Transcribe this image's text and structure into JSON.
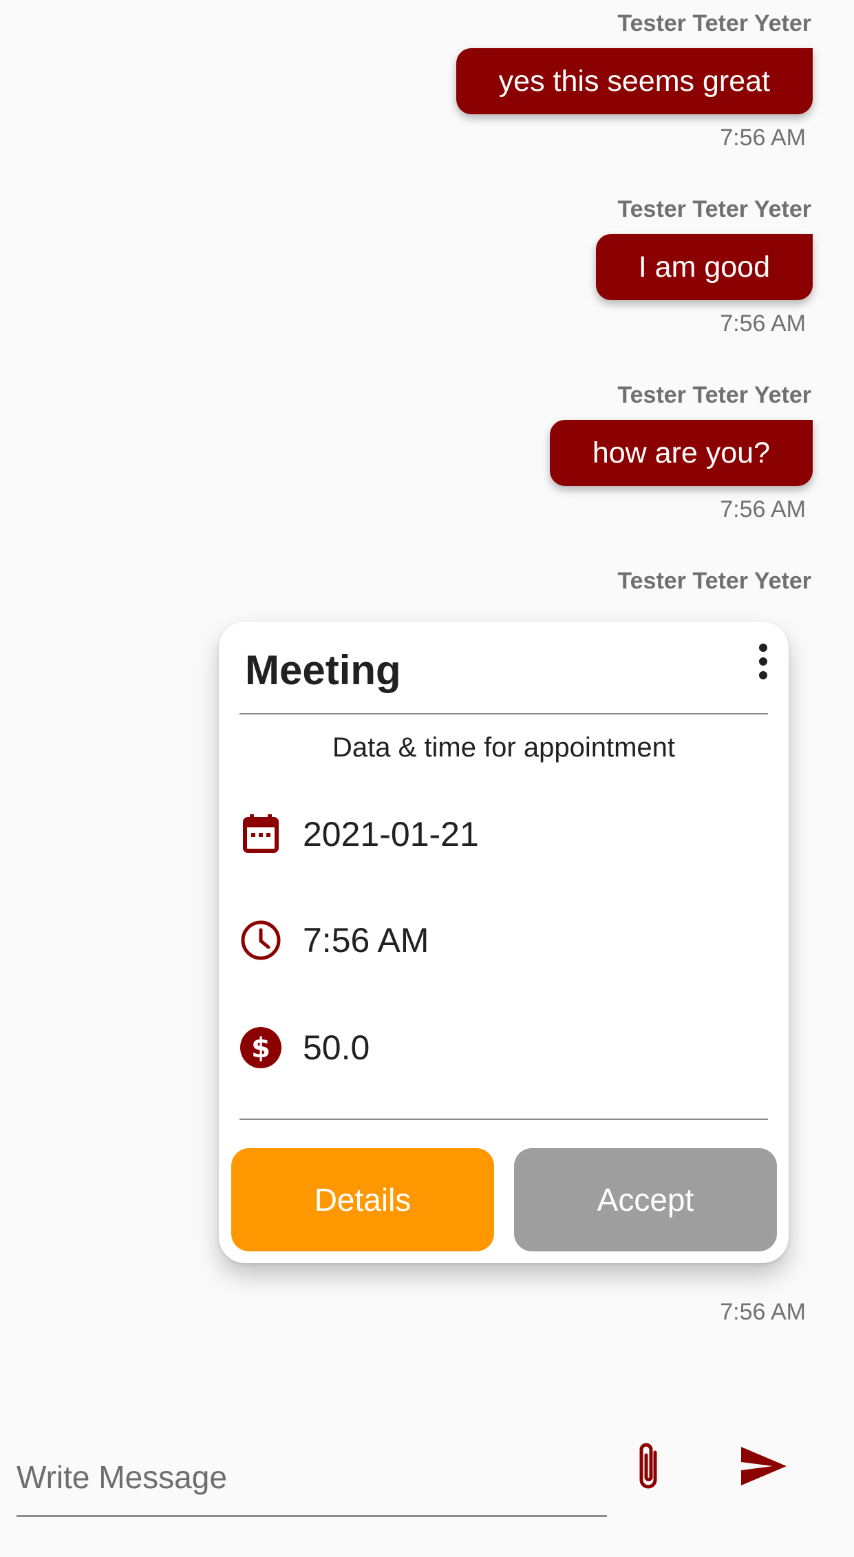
{
  "messages": [
    {
      "sender": "Tester Teter Yeter",
      "text": "yes this seems great",
      "time": "7:56 AM"
    },
    {
      "sender": "Tester Teter Yeter",
      "text": "I am good",
      "time": "7:56 AM"
    },
    {
      "sender": "Tester Teter Yeter",
      "text": "how are you?",
      "time": "7:56 AM"
    }
  ],
  "appointment": {
    "sender": "Tester Teter Yeter",
    "title": "Meeting",
    "subtitle": "Data & time for appointment",
    "date": "2021-01-21",
    "time_value": "7:56 AM",
    "price": "50.0",
    "details_label": "Details",
    "accept_label": "Accept",
    "time": "7:56 AM"
  },
  "composer": {
    "placeholder": "Write Message",
    "value": ""
  },
  "colors": {
    "bubble": "#8b0000",
    "details_button": "#ff9800",
    "accept_button": "#9e9e9e",
    "icon": "#8b0000"
  },
  "icons": {
    "menu": "more-vert-icon",
    "date": "calendar-icon",
    "time": "clock-icon",
    "price": "dollar-icon",
    "attach": "paperclip-icon",
    "send": "send-icon"
  }
}
